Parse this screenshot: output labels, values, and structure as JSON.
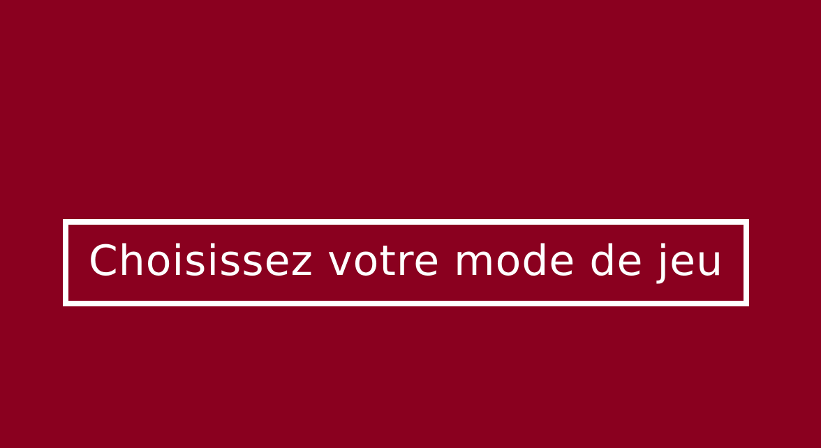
{
  "screen": {
    "background_color": "#8a001f",
    "text_color": "#ffffff",
    "title": "Choisissez votre mode de jeu"
  }
}
